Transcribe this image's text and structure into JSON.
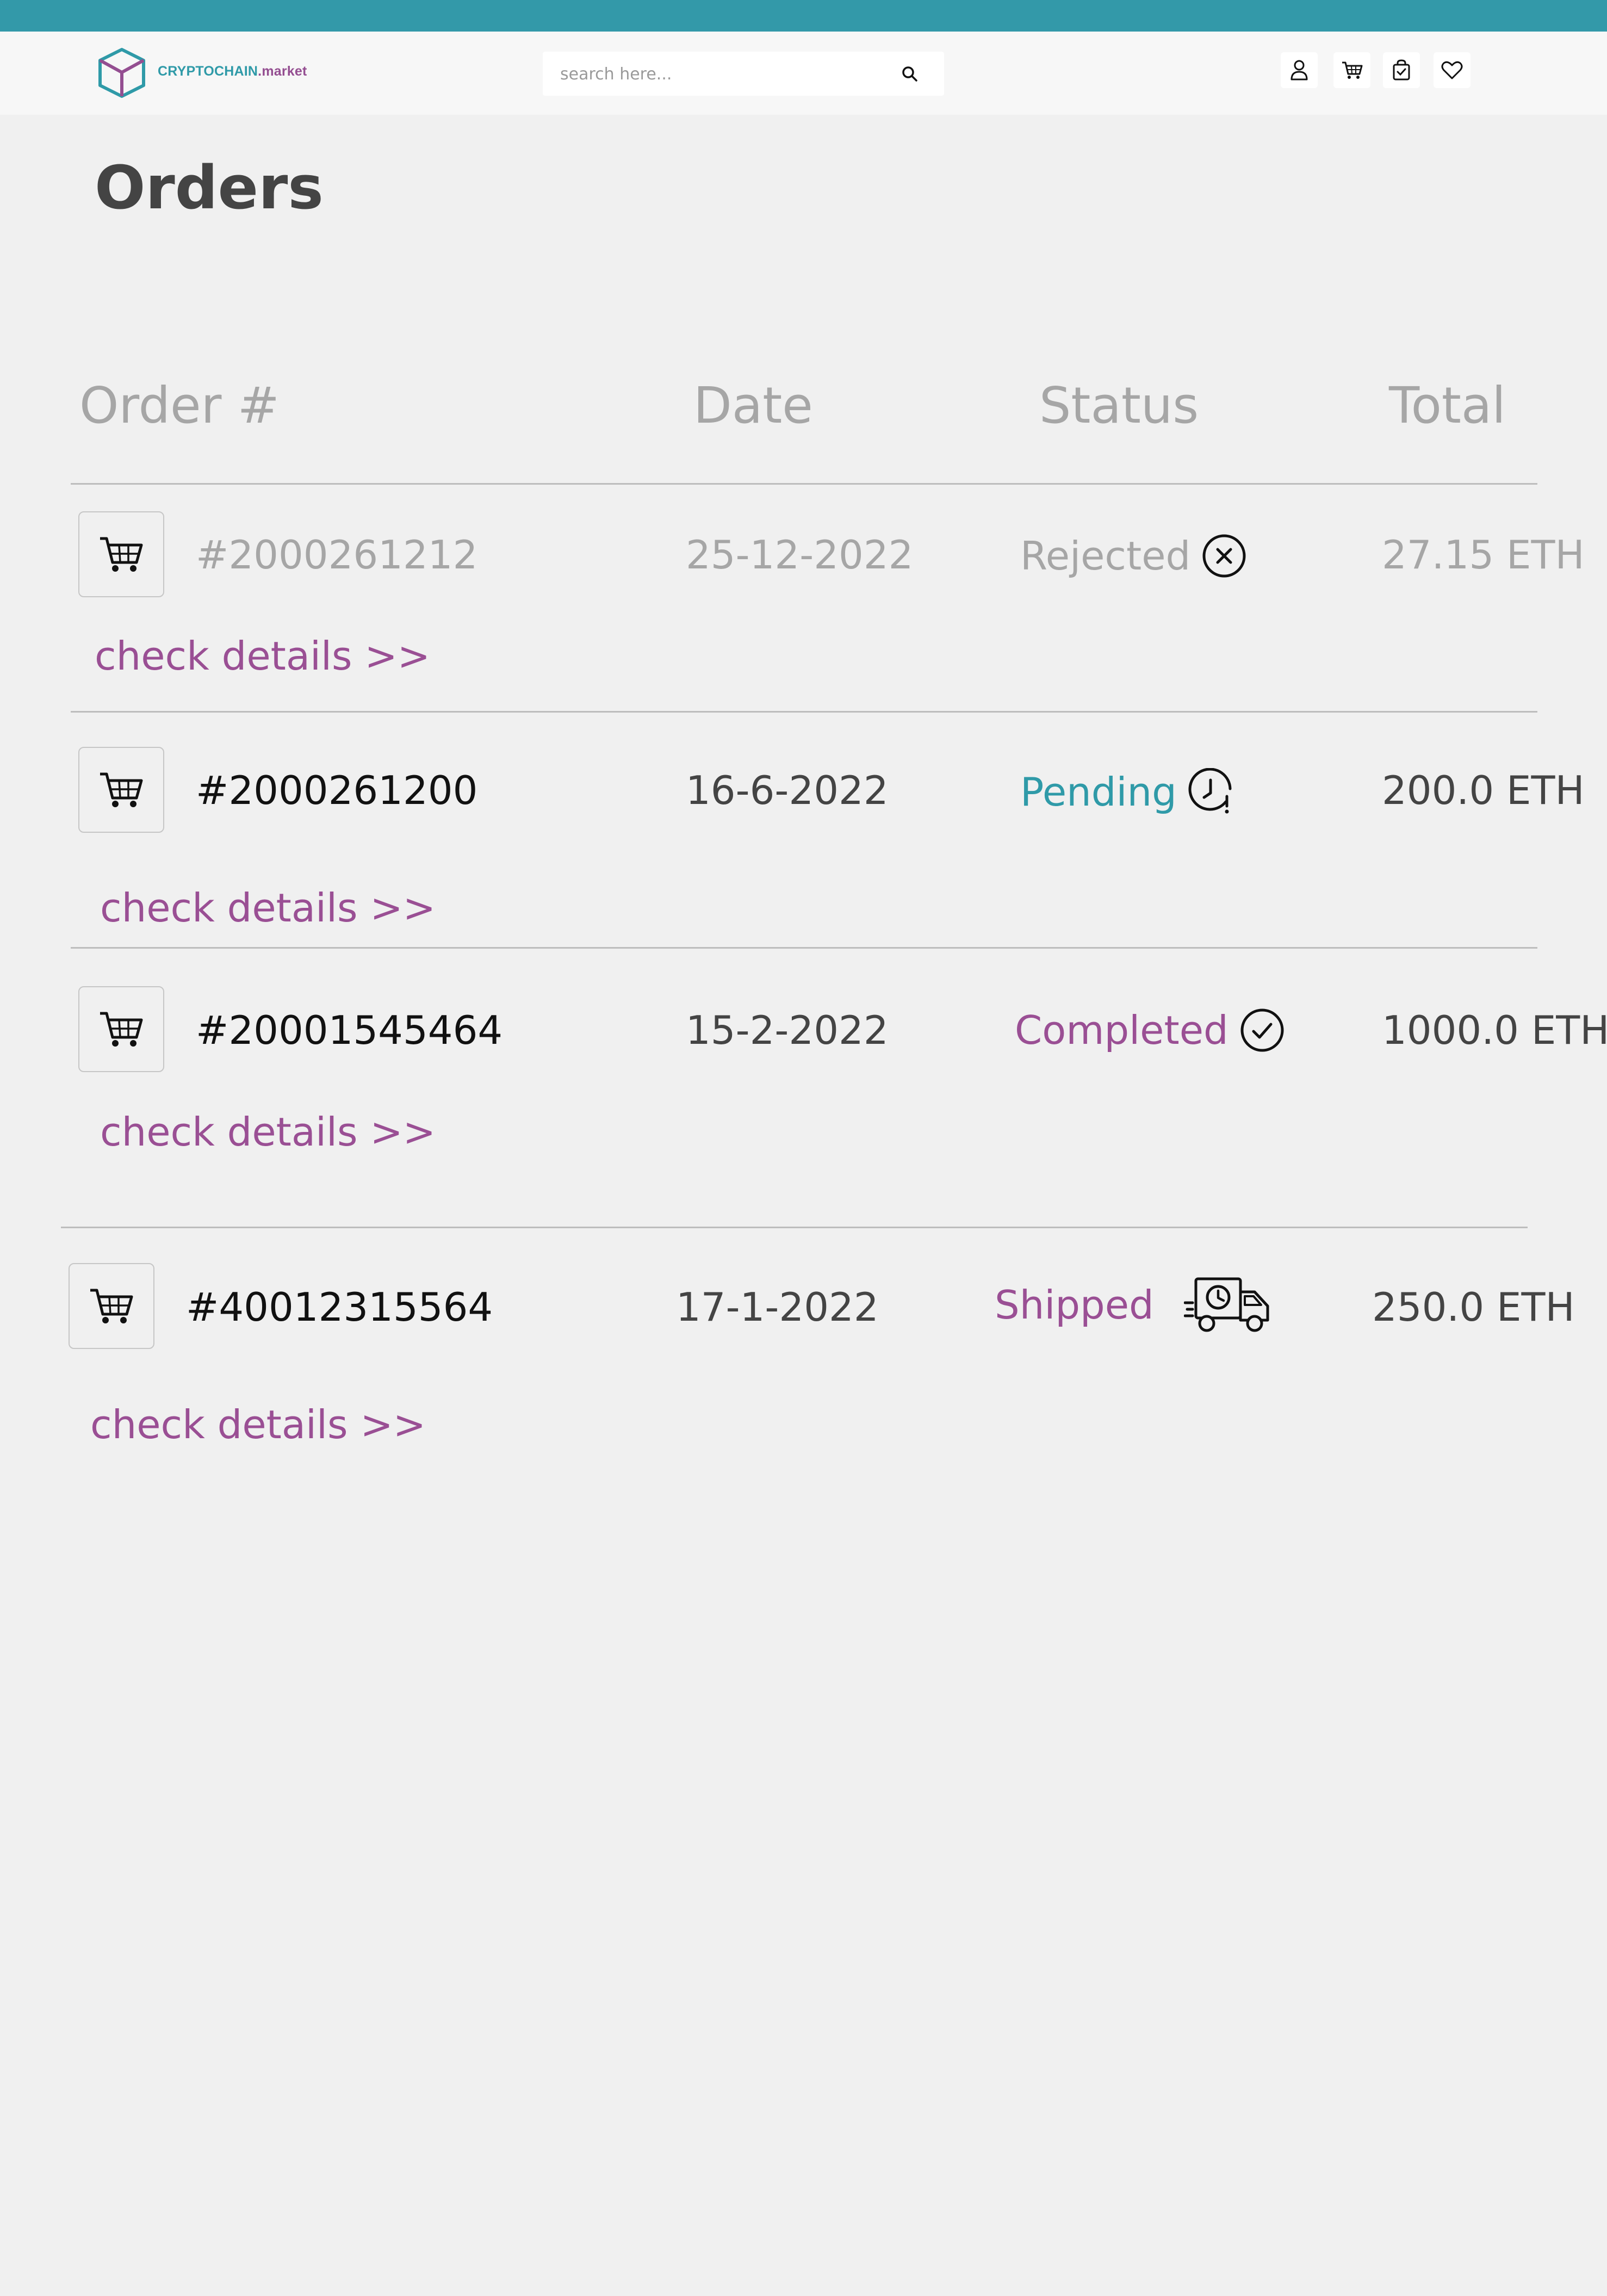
{
  "brand": {
    "name_part1": "CRYPTOCHAIN",
    "name_part2": ".market"
  },
  "search": {
    "placeholder": "search here..."
  },
  "header_icons": [
    "user-icon",
    "cart-icon",
    "shopping-bag-icon",
    "heart-icon"
  ],
  "page": {
    "title": "Orders"
  },
  "table": {
    "columns": [
      "Order #",
      "Date",
      "Status",
      "Total"
    ],
    "orders": [
      {
        "number": "#2000261212",
        "date": "25-12-2022",
        "status": "Rejected",
        "status_icon": "x-circle-icon",
        "total": "27.15 ETH",
        "details_label": "check details >>"
      },
      {
        "number": "#2000261200",
        "date": "16-6-2022",
        "status": "Pending",
        "status_icon": "clock-alert-icon",
        "total": "200.0 ETH",
        "details_label": "check details >>"
      },
      {
        "number": "#20001545464",
        "date": "15-2-2022",
        "status": "Completed",
        "status_icon": "check-circle-icon",
        "total": "1000.0 ETH",
        "details_label": "check details >>"
      },
      {
        "number": "#40012315564",
        "date": "17-1-2022",
        "status": "Shipped",
        "status_icon": "delivery-truck-icon",
        "total": "250.0 ETH",
        "details_label": "check details >>"
      }
    ]
  },
  "colors": {
    "topbar": "#3399a9",
    "brand_teal": "#2f9aa8",
    "brand_purple": "#944e91",
    "rejected": "#a6a6a6",
    "pending": "#2f9aa8",
    "completed": "#9a4f94",
    "shipped": "#9a4f94"
  }
}
